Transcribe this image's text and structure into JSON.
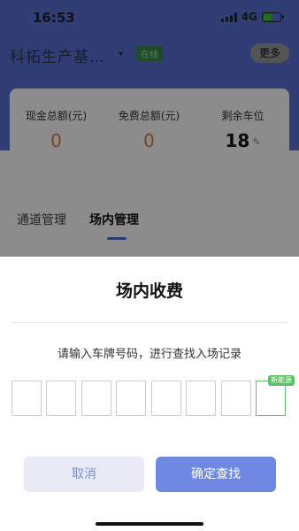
{
  "status_bar": {
    "time": "16:53",
    "network": "4G"
  },
  "header": {
    "site_name": "科拓生产基…",
    "online_badge": "在线",
    "more_label": "更多"
  },
  "stats": [
    {
      "label": "现金总额(元)",
      "value": "0"
    },
    {
      "label": "免费总额(元)",
      "value": "0"
    },
    {
      "label": "剩余车位",
      "value": "18"
    }
  ],
  "tabs": [
    {
      "label": "通道管理",
      "active": false
    },
    {
      "label": "场内管理",
      "active": true
    }
  ],
  "dialog": {
    "title": "场内收费",
    "hint": "请输入车牌号码，进行查找入场记录",
    "plate_slots": [
      "",
      "",
      "",
      "",
      "",
      "",
      "",
      ""
    ],
    "new_energy_tag": "新能源",
    "cancel_label": "取消",
    "confirm_label": "确定查找"
  },
  "colors": {
    "header_bg": "#5a72d6",
    "accent": "#6e88e3",
    "value_orange": "#e57a3a",
    "new_energy_green": "#5bbf64"
  }
}
